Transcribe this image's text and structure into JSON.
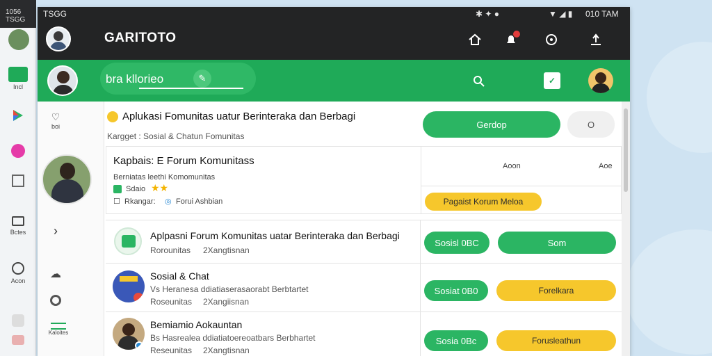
{
  "os": {
    "status_left": "1056 TSGG",
    "status_right": "010 TAM",
    "rail": [
      {
        "label": "Incl",
        "icon": "tag-icon"
      },
      {
        "label": "",
        "icon": "maps-icon"
      },
      {
        "label": "",
        "icon": "podcast-icon"
      },
      {
        "label": "",
        "icon": "slides-icon"
      },
      {
        "label": "Bctes",
        "icon": "briefcase-icon"
      },
      {
        "label": "Acon",
        "icon": "info-icon"
      }
    ]
  },
  "app": {
    "title": "GARITOTO",
    "status_time": "TSGG",
    "status_right": "010 TAM",
    "search": {
      "value": "bra kllorieo"
    },
    "sidebar": [
      {
        "label": "boi",
        "icon": "heart-icon"
      },
      {
        "label": "",
        "icon": "chevron-right-icon"
      },
      {
        "label": "",
        "icon": "cloud-icon"
      },
      {
        "label": "",
        "icon": "circle-icon"
      },
      {
        "label": "Kaloites",
        "icon": "layers-icon"
      }
    ],
    "header": {
      "title": "Aplukasi Fomunitas  uatur Berinteraka dan Berbagi",
      "subtitle": "Kargget : Sosial & Chatun Fomunitas",
      "primary_button": "Gerdop",
      "secondary_button": "O",
      "col_a": "Aoon",
      "col_b": "Aoe"
    },
    "featured": {
      "title": "Kapbais: E Forum Komunitass",
      "line1": "Berniatas leethi Komomunitas",
      "line2": "Sdaio",
      "line3a": "Rkangar:",
      "line3b": "Forui Ashbian",
      "tag": "Pagaist Korum Meloa"
    },
    "items": [
      {
        "title": "Aplpasni Forum Komunitas uatar Berinteraka dan Berbagi",
        "sub1": "Rorounitas",
        "sub2": "2Xangtisnan",
        "tag_a": "Sosisl 0BC",
        "tag_b": "Som"
      },
      {
        "title": "Sosial & Chat",
        "sub1": "Vs Heranesa ddiatiaserasaorabt Berbtartet",
        "sub2": "Roseunitas",
        "sub3": "2Xangiisnan",
        "tag_a": "Sosiat 0B0",
        "tag_b": "Forelkara"
      },
      {
        "title": "Bemiamio Aokauntan",
        "sub1": "Bs Hasrealea ddiatiatoereoatbars Berbhartet",
        "sub2": "Reseunitas",
        "sub3": "2Xangtisnan",
        "tag_a": "Sosia 0Bc",
        "tag_b": "Forusleathun"
      }
    ]
  },
  "colors": {
    "green": "#1faa58",
    "dark": "#232425",
    "yellow": "#f6c72c",
    "badge": "#e23c3c"
  }
}
